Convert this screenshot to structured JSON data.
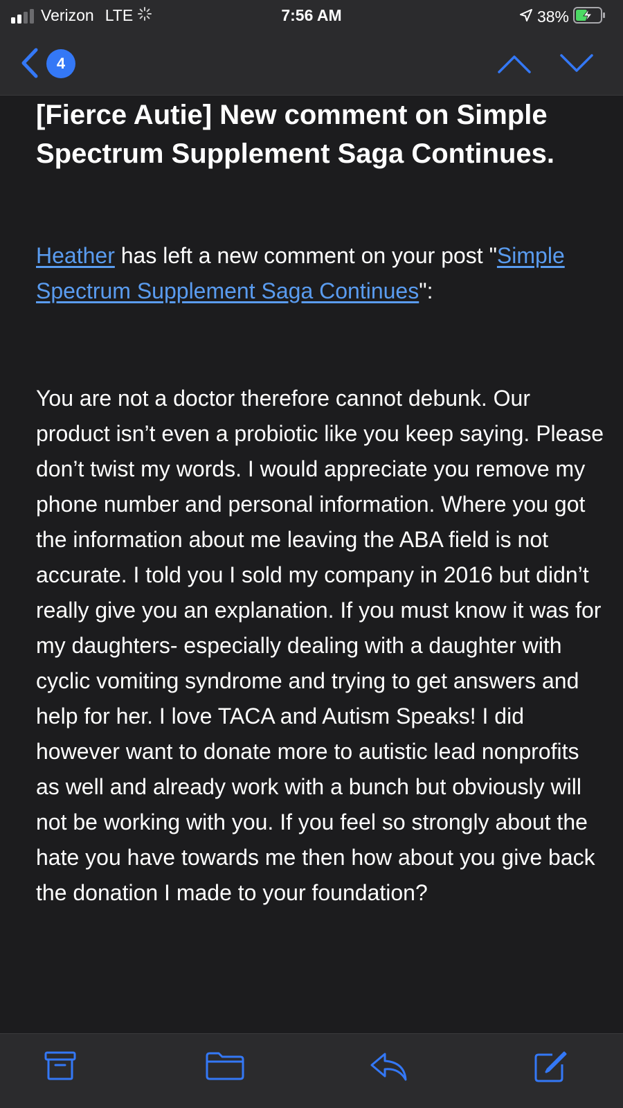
{
  "status_bar": {
    "carrier": "Verizon",
    "network": "LTE",
    "time": "7:56 AM",
    "battery_percent": "38%",
    "signal_bars_active": 2,
    "signal_bars_total": 4,
    "icons": [
      "signal-icon",
      "loading-icon",
      "location-arrow-icon",
      "battery-charging-icon"
    ]
  },
  "nav": {
    "unread_count": "4",
    "icons": [
      "back-chevron-icon",
      "chevron-up-icon",
      "chevron-down-icon"
    ]
  },
  "email": {
    "subject": "[Fierce Autie] New comment on Simple Spectrum Supplement Saga Continues.",
    "intro": {
      "author_link": "Heather",
      "text_after_author": " has left a new comment on your post \"",
      "post_link": "Simple Spectrum Supplement Saga Continues",
      "text_end": "\":"
    },
    "body": "You are not a doctor therefore cannot debunk. Our product isn’t even a probiotic like you keep saying. Please don’t twist my words. I would appreciate you remove my phone number and personal information. Where you got the information about me leaving the ABA field is not accurate. I told you I sold my company in 2016 but didn’t really give you an explanation. If you must know it was for my daughters- especially dealing with a daughter with cyclic vomiting syndrome and trying to get answers and help for her. I love TACA and Autism Speaks! I did however want to donate more to autistic lead nonprofits as well and already work with a bunch but obviously will not be working with you. If you feel so strongly about the hate you have towards me then how about you give back the donation I made to your foundation?"
  },
  "toolbar": {
    "icons": [
      "archive-icon",
      "folder-icon",
      "reply-icon",
      "compose-icon"
    ]
  },
  "colors": {
    "background": "#1c1c1e",
    "bar_background": "#2b2b2d",
    "accent": "#3478f6",
    "link": "#5a9cf0",
    "battery_fill": "#4cd964"
  }
}
